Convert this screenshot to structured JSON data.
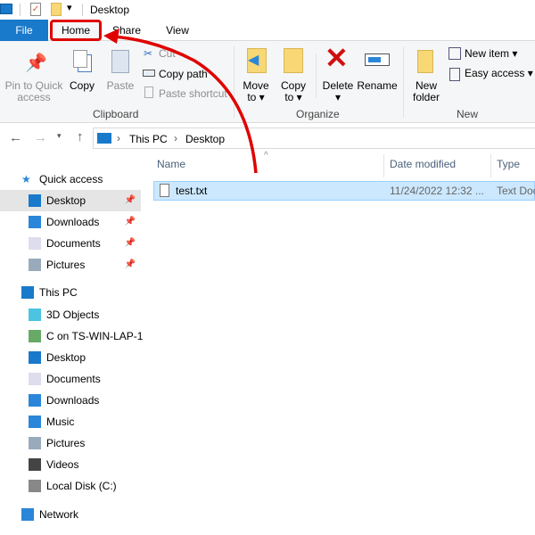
{
  "window": {
    "title": "Desktop"
  },
  "tabs": [
    {
      "label": "File"
    },
    {
      "label": "Home"
    },
    {
      "label": "Share"
    },
    {
      "label": "View"
    }
  ],
  "ribbon": {
    "clipboard": {
      "group": "Clipboard",
      "pin": "Pin to Quick access",
      "copy": "Copy",
      "paste": "Paste",
      "cut": "Cut",
      "copy_path": "Copy path",
      "paste_shortcut": "Paste shortcut"
    },
    "organize": {
      "group": "Organize",
      "move_to": "Move to",
      "copy_to": "Copy to",
      "delete": "Delete",
      "rename": "Rename"
    },
    "new": {
      "group": "New",
      "new_folder": "New folder",
      "new_item": "New item",
      "easy_access": "Easy access"
    }
  },
  "address": {
    "parts": [
      "This PC",
      "Desktop"
    ]
  },
  "sidebar": {
    "items": [
      {
        "label": "Quick access",
        "icon": "star-icon"
      },
      {
        "label": "Desktop",
        "icon": "desktop-icon",
        "pinned": true
      },
      {
        "label": "Downloads",
        "icon": "download-icon",
        "pinned": true
      },
      {
        "label": "Documents",
        "icon": "documents-icon",
        "pinned": true
      },
      {
        "label": "Pictures",
        "icon": "pictures-icon",
        "pinned": true
      },
      {
        "label": "This PC",
        "icon": "pc-icon"
      },
      {
        "label": "3D Objects",
        "icon": "cube-icon"
      },
      {
        "label": "C on TS-WIN-LAP-1",
        "icon": "network-drive-icon"
      },
      {
        "label": "Desktop",
        "icon": "desktop-icon"
      },
      {
        "label": "Documents",
        "icon": "documents-icon"
      },
      {
        "label": "Downloads",
        "icon": "download-icon"
      },
      {
        "label": "Music",
        "icon": "music-icon"
      },
      {
        "label": "Pictures",
        "icon": "pictures-icon"
      },
      {
        "label": "Videos",
        "icon": "videos-icon"
      },
      {
        "label": "Local Disk (C:)",
        "icon": "disk-icon"
      },
      {
        "label": "Network",
        "icon": "network-icon"
      }
    ]
  },
  "columns": [
    "Name",
    "Date modified",
    "Type"
  ],
  "files": [
    {
      "name": "test.txt",
      "date": "11/24/2022 12:32 ...",
      "type": "Text Doc"
    }
  ],
  "colors": {
    "accent": "#1979ca",
    "highlight": "#e00000",
    "selection": "#cce8ff"
  }
}
